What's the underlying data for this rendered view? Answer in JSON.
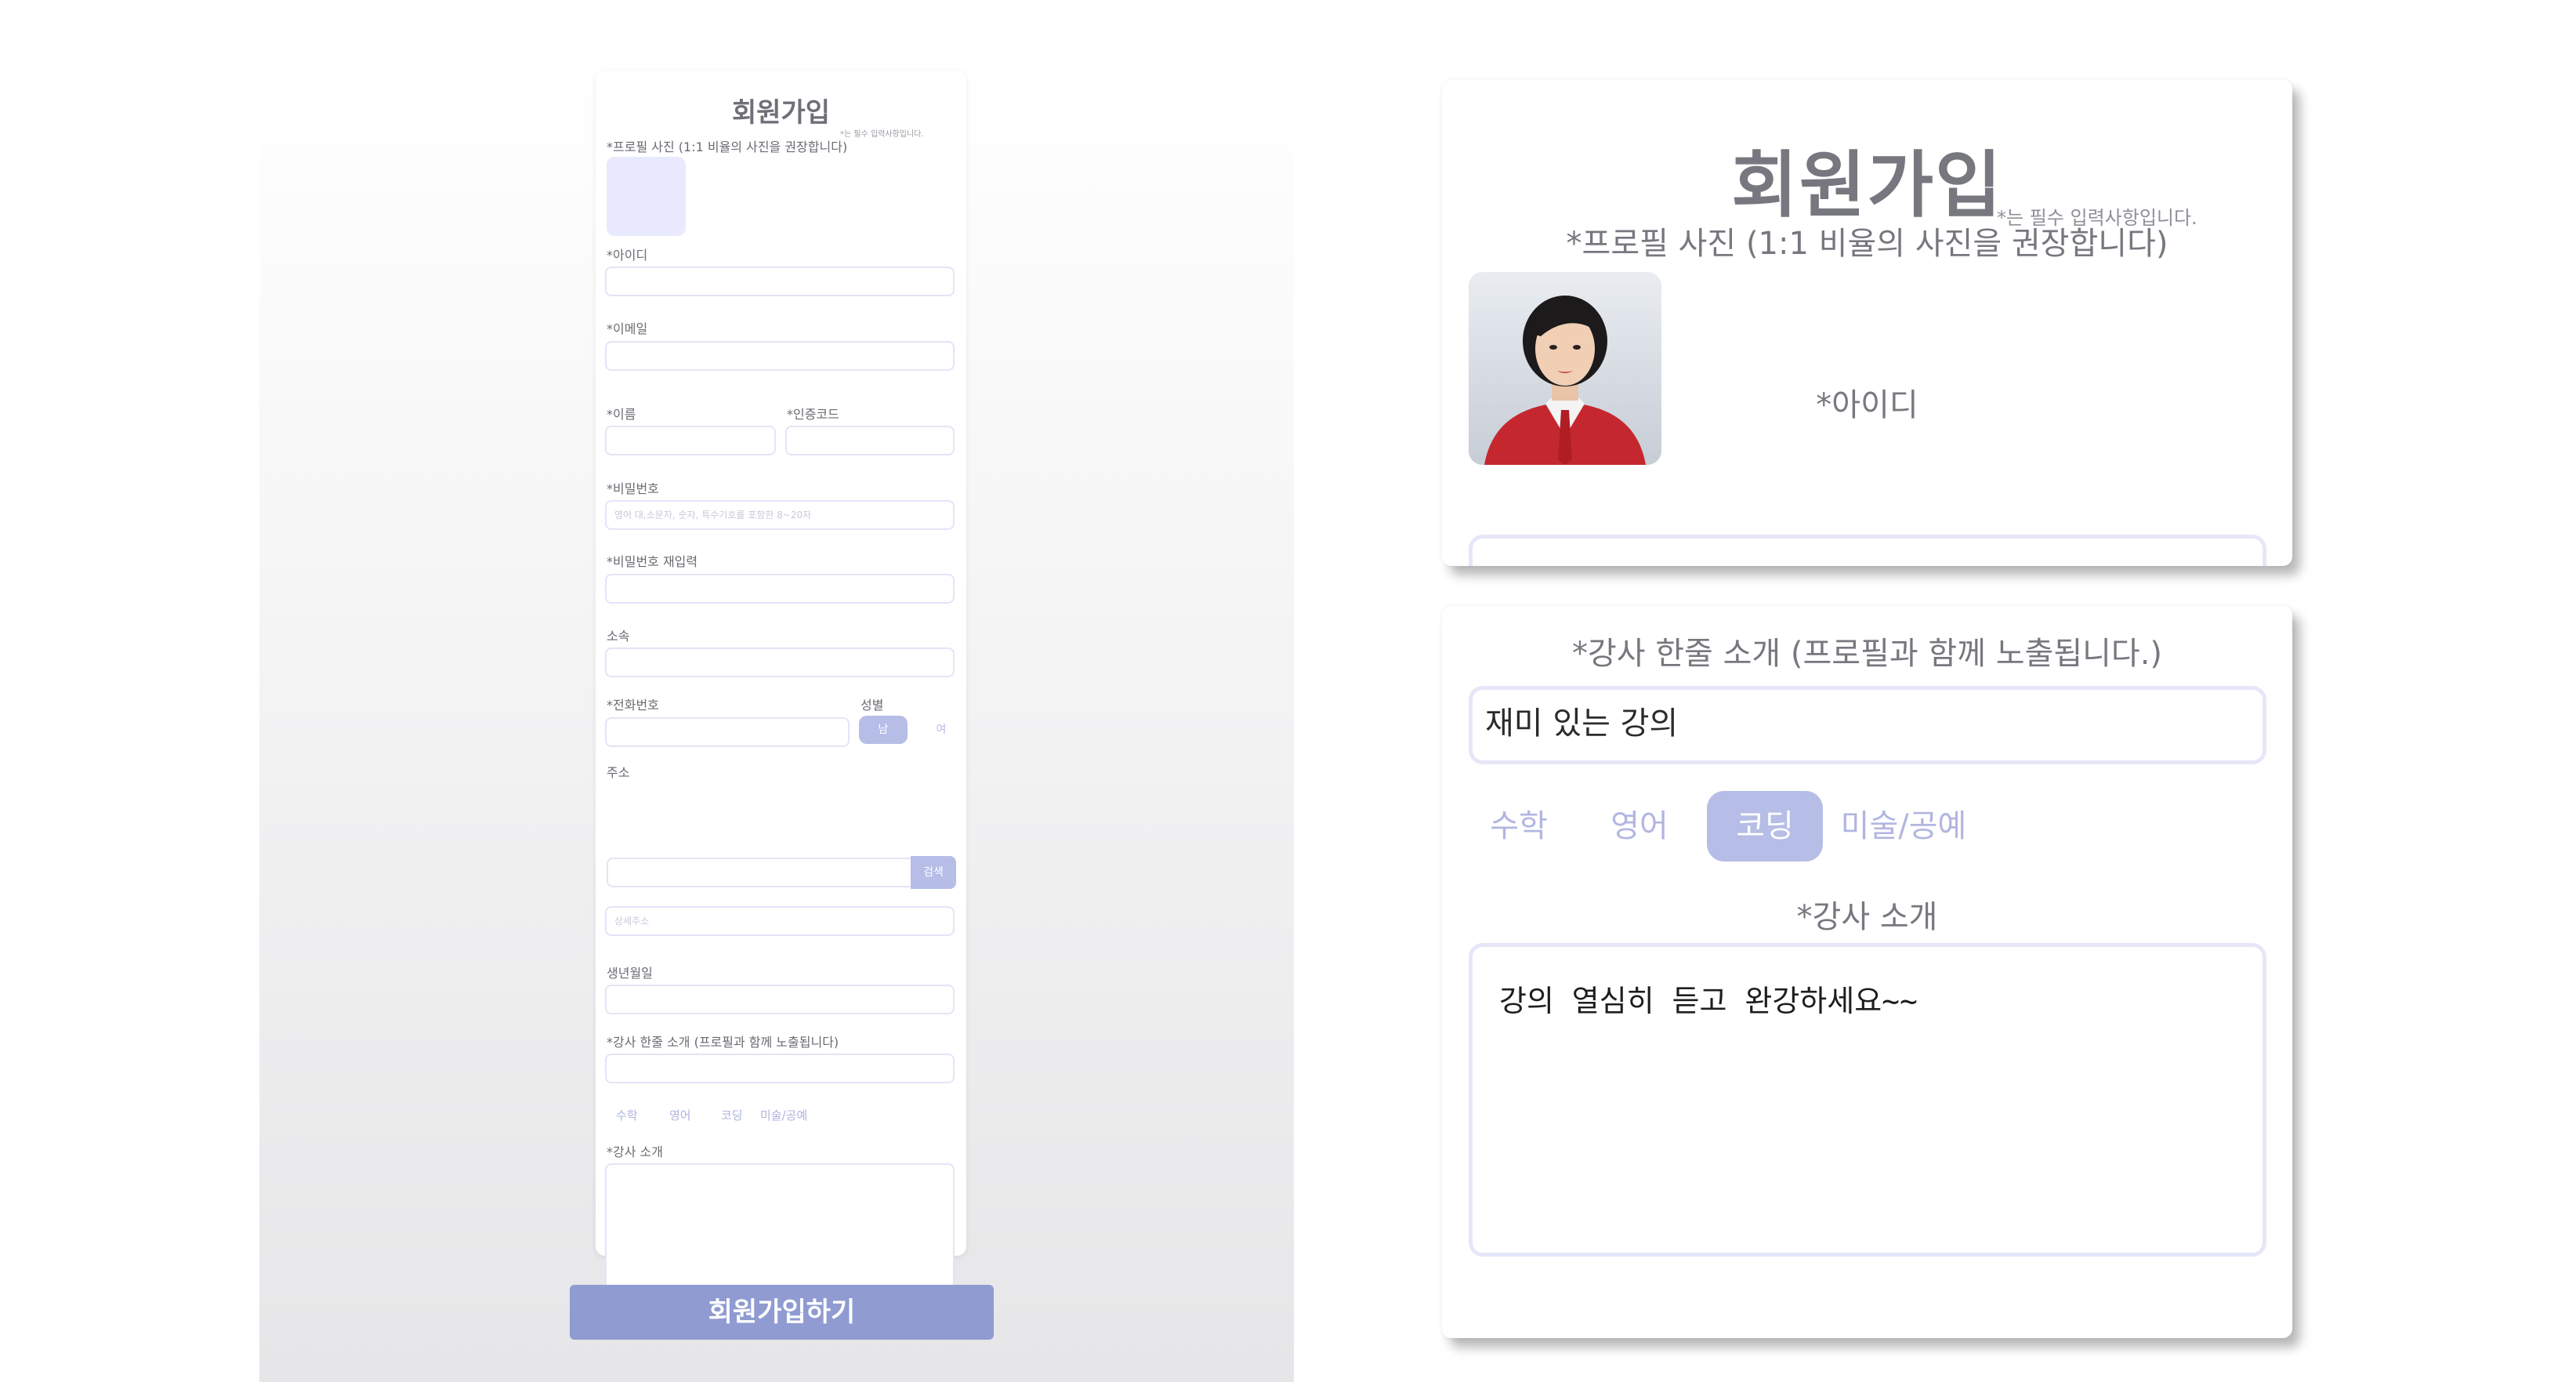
{
  "form": {
    "title": "회원가입",
    "required_note": "*는 필수 입력사항입니다.",
    "photo_label": "*프로필 사진 (1:1 비율의 사진을 권장합니다)",
    "id_label": "*아이디",
    "email_label": "*이메일",
    "name_label": "*이름",
    "code_label": "*인증코드",
    "password_label": "*비밀번호",
    "password_placeholder": "영어 대,소문자, 숫자, 특수기호를 포함한 8~20자",
    "password_confirm_label": "*비밀번호 재입력",
    "affiliation_label": "소속",
    "phone_label": "*전화번호",
    "gender_label": "성별",
    "gender_male": "남",
    "gender_female": "여",
    "address_label": "주소",
    "search_button": "검색",
    "address_detail_placeholder": "상세주소",
    "birth_label": "생년월일",
    "intro_short_label": "*강사 한줄 소개 (프로필과 함께 노출됩니다)",
    "subjects": [
      "수학",
      "영어",
      "코딩",
      "미술/공예"
    ],
    "intro_label": "*강사 소개",
    "submit_label": "회원가입하기"
  },
  "zoom_top": {
    "title": "회원가입",
    "required_note": "*는 필수 입력사항입니다.",
    "photo_label": "*프로필 사진 (1:1 비율의 사진을 권장합니다)",
    "id_label": "*아이디"
  },
  "zoom_bottom": {
    "intro_short_label": "*강사 한줄 소개 (프로필과 함께 노출됩니다.)",
    "intro_short_value": "재미 있는 강의",
    "subjects": [
      "수학",
      "영어",
      "코딩",
      "미술/공예"
    ],
    "selected_subject": "코딩",
    "intro_label": "*강사 소개",
    "intro_value": "강의 열심히 듣고 완강하세요~~"
  },
  "colors": {
    "accent": "#b6bde6",
    "submit": "#8f9bd1",
    "photo_placeholder": "#e9eafe",
    "input_border": "#e4e4f8"
  }
}
